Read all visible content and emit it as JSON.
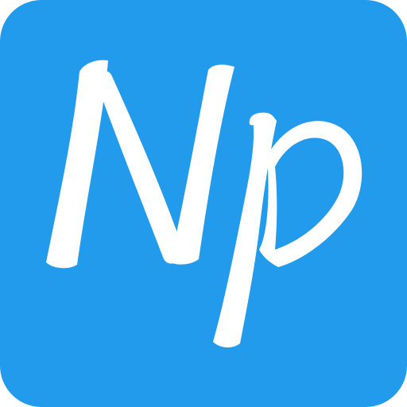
{
  "icon": {
    "name": "np-logo-icon",
    "logo_text": "Np",
    "colors": {
      "tile": "#229BEC",
      "glyph": "#FFFFFF"
    }
  }
}
